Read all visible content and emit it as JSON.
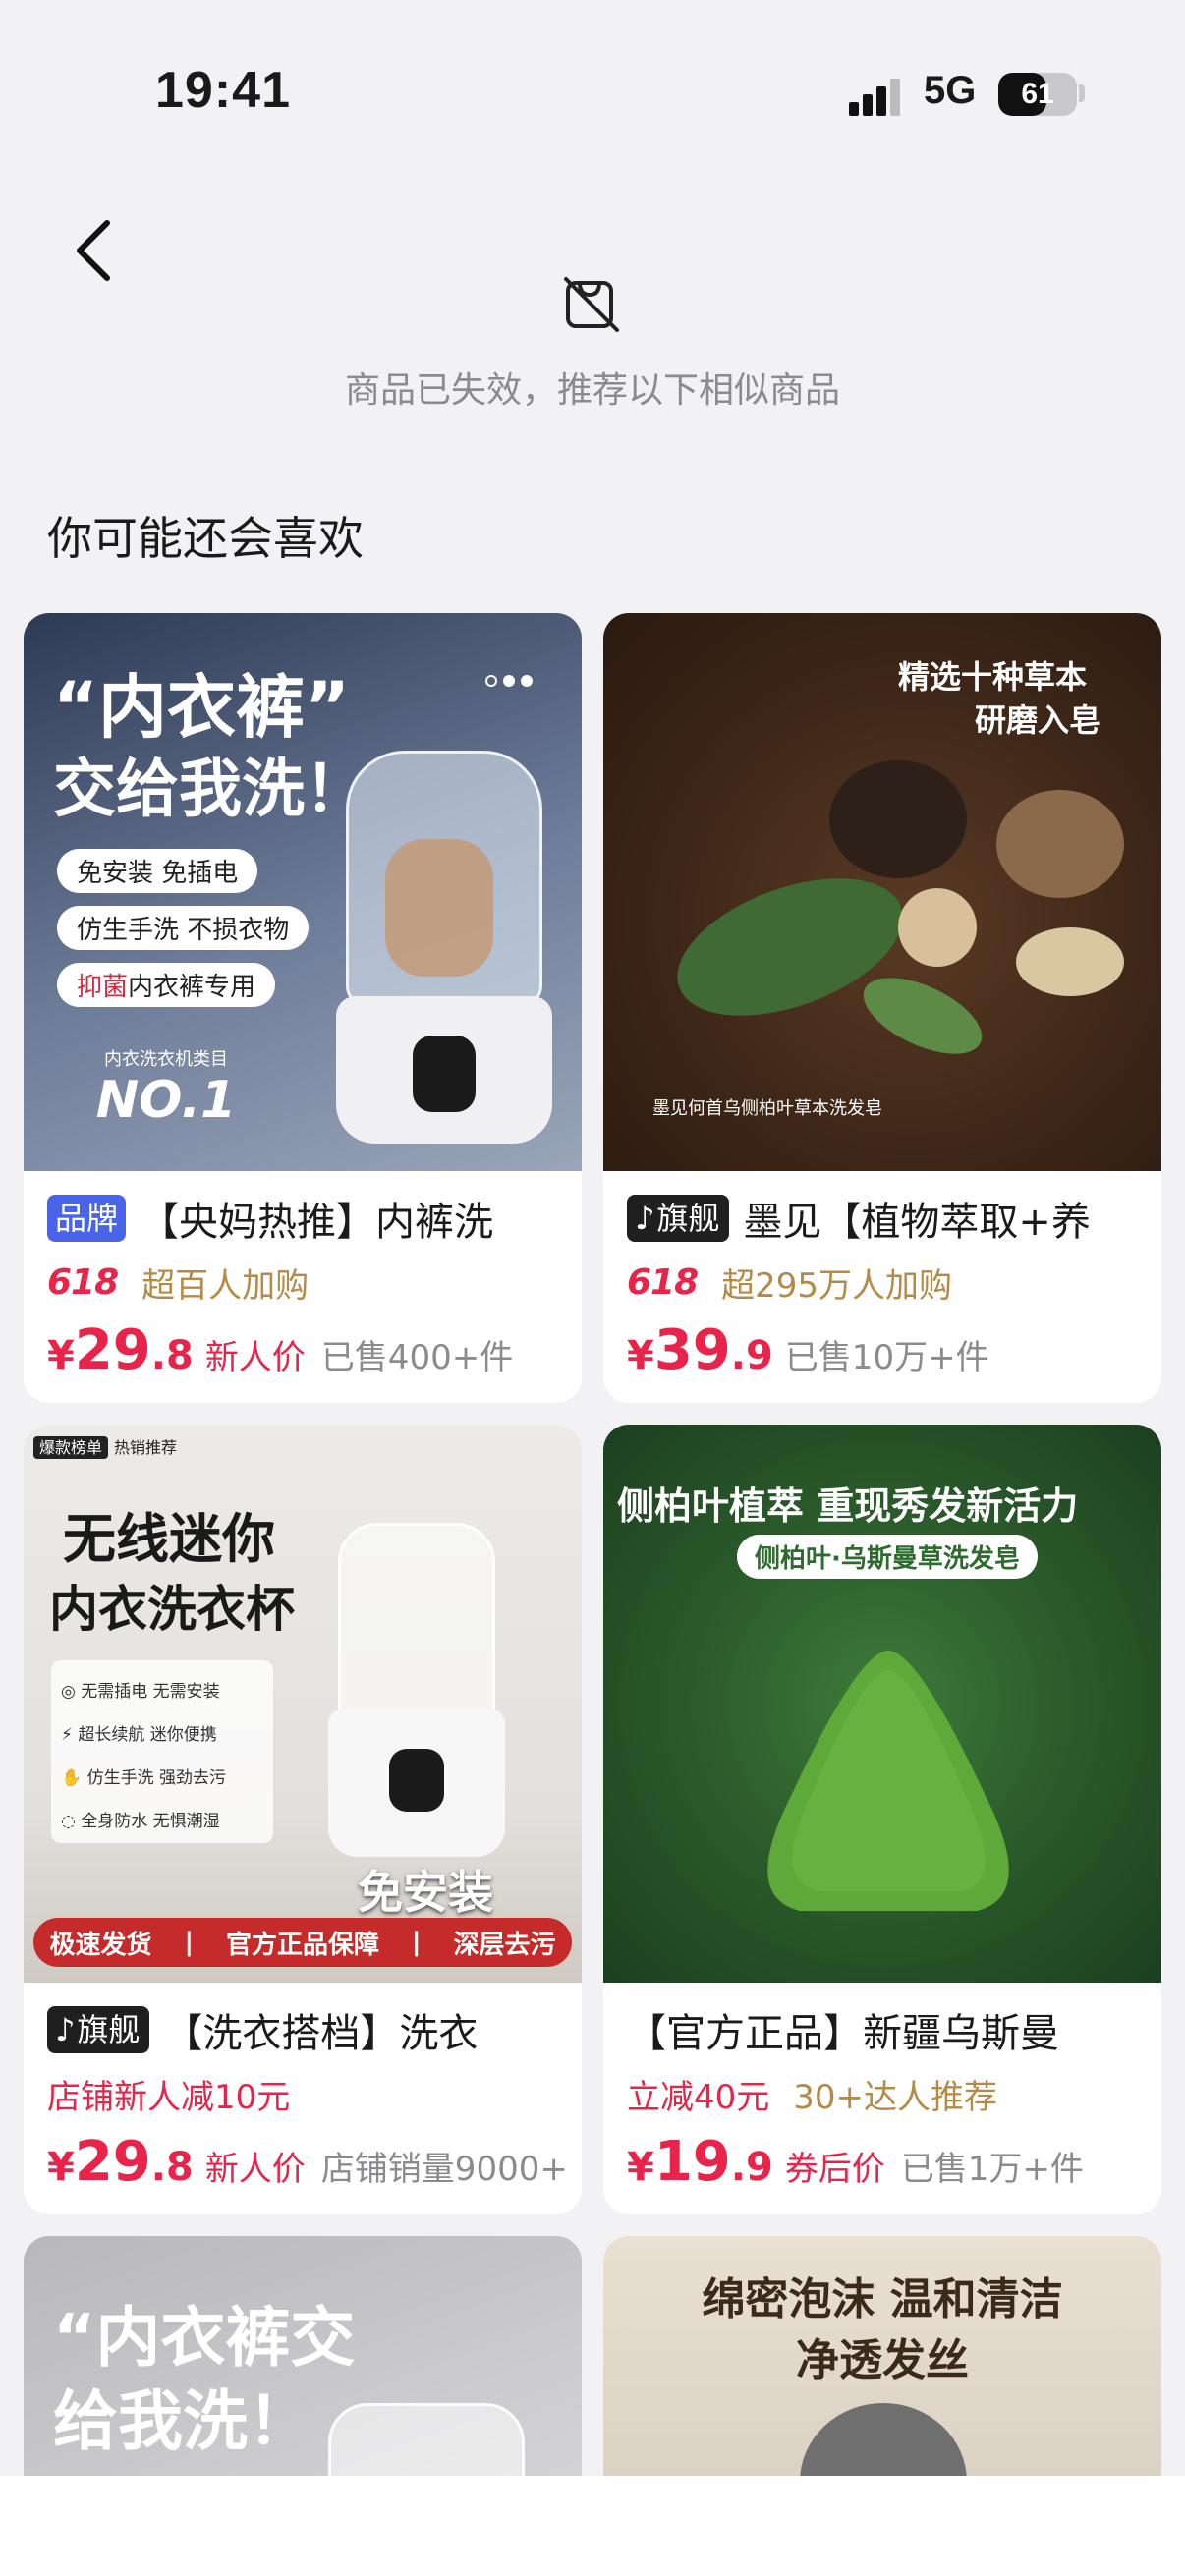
{
  "status_bar": {
    "time": "19:41",
    "network": "5G",
    "battery": "61",
    "battery_level": 0.61
  },
  "notice": {
    "text": "商品已失效，推荐以下相似商品"
  },
  "section": {
    "title": "你可能还会喜欢"
  },
  "products": [
    {
      "badge": "品牌",
      "badge_type": "brand",
      "title": "【央妈热推】内裤洗",
      "promo_tag": "618",
      "promo": "超百人加购",
      "price_int": "29",
      "price_dec": ".8",
      "price_note": "新人价",
      "sold": "已售400+件",
      "image": {
        "headline1": "“内衣裤”",
        "headline2": "交给我洗！",
        "pill1": "免安装 免插电",
        "pill2": "仿生手洗 不损衣物",
        "pill3_strong": "抑菌",
        "pill3": "内衣裤专用",
        "award_top": "内衣洗衣机类目",
        "award": "NO.1"
      }
    },
    {
      "badge": "旗舰",
      "badge_type": "flagship",
      "title": "墨见【植物萃取+养",
      "promo_tag": "618",
      "promo": "超295万人加购",
      "price_int": "39",
      "price_dec": ".9",
      "price_note": "",
      "sold": "已售10万+件",
      "image": {
        "caption1": "精选十种草本",
        "caption2": "研磨入皂",
        "footer": "墨见何首乌侧柏叶草本洗发皂"
      }
    },
    {
      "badge": "旗舰",
      "badge_type": "flagship",
      "title": "【洗衣搭档】洗衣",
      "promo_tag": "",
      "promo": "店铺新人减10元",
      "price_int": "29",
      "price_dec": ".8",
      "price_note": "新人价",
      "sold": "店铺销量9000+",
      "image": {
        "corner1": "爆款榜单",
        "corner2": "热销推荐",
        "headline1": "无线迷你",
        "headline2": "内衣洗衣杯",
        "feat1": "无需插电 无需安装",
        "feat2": "超长续航 迷你便携",
        "feat3": "仿生手洗 强劲去污",
        "feat4": "全身防水 无惧潮湿",
        "big": "免安装",
        "bar1": "极速发货",
        "bar2": "官方正品保障",
        "bar3": "深层去污"
      }
    },
    {
      "badge": "",
      "badge_type": "",
      "title": "【官方正品】新疆乌斯曼",
      "promo_tag": "",
      "promo": "立减40元",
      "promo2": "30+达人推荐",
      "price_int": "19",
      "price_dec": ".9",
      "price_note": "券后价",
      "sold": "已售1万+件",
      "image": {
        "headline": "侧柏叶植萃 重现秀发新活力",
        "pill": "侧柏叶·乌斯曼草洗发皂"
      }
    },
    {
      "image": {
        "headline1": "“内衣裤交",
        "headline2": "给我洗！"
      }
    },
    {
      "image": {
        "headline1": "绵密泡沫 温和清洁",
        "headline2": "净透发丝"
      }
    }
  ]
}
